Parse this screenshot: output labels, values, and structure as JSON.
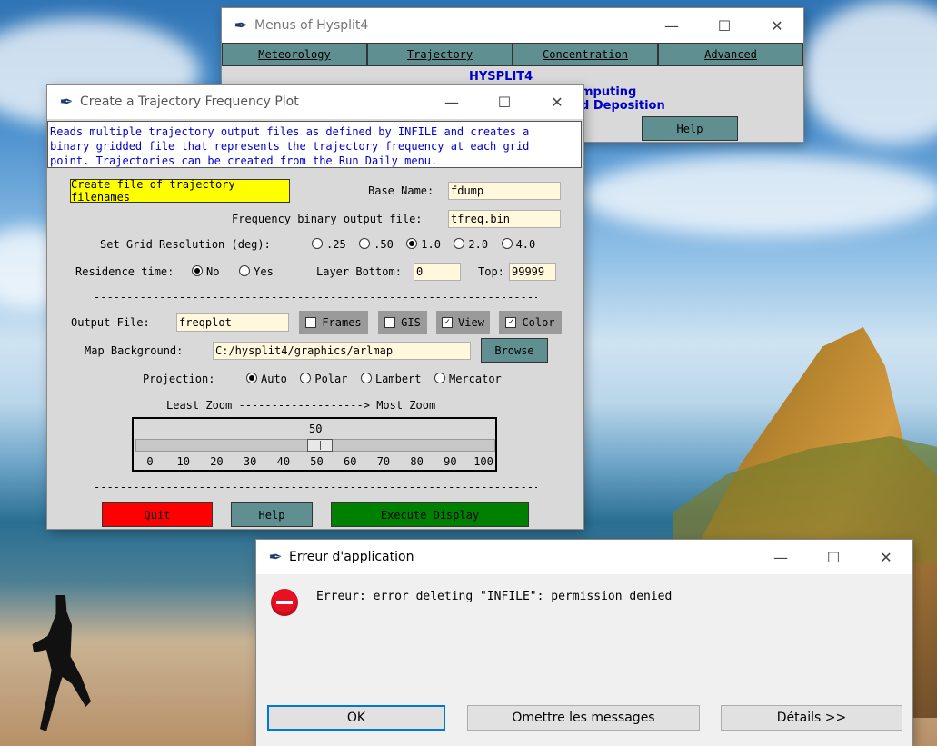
{
  "colors": {
    "yellow_button": "#ffff00",
    "quit_red": "#ff0000",
    "execute_green": "#008000",
    "teal_button": "#5f8f90",
    "entry_bg": "#fff8dc",
    "info_text": "#0000cc",
    "error_red": "#e81123"
  },
  "menus_window": {
    "title": "Menus of Hysplit4",
    "menu": [
      "Meteorology",
      "Trajectory",
      "Concentration",
      "Advanced"
    ],
    "heading": "HYSPLIT4",
    "line2_partial": "mputing",
    "line3_partial": "d Deposition",
    "help_label": "Help"
  },
  "traj_window": {
    "title": "Create a Trajectory Frequency Plot",
    "description": "Reads multiple trajectory output files as defined by INFILE and creates a\nbinary gridded file that represents the trajectory frequency at each grid\npoint. Trajectories can be created from the Run Daily menu.",
    "create_button": "Create file of trajectory filenames",
    "base_name_label": "Base Name:",
    "base_name_value": "fdump",
    "freq_file_label": "Frequency binary output file:",
    "freq_file_value": "tfreq.bin",
    "grid_label": "Set Grid Resolution (deg):",
    "grid_options": [
      ".25",
      ".50",
      "1.0",
      "2.0",
      "4.0"
    ],
    "grid_selected": "1.0",
    "residence_label": "Residence time:",
    "residence_options": [
      "No",
      "Yes"
    ],
    "residence_selected": "No",
    "layer_bottom_label": "Layer Bottom:",
    "layer_bottom_value": "0",
    "top_label": "Top:",
    "top_value": "99999",
    "separator": "----------------------------------------------------------------------",
    "output_file_label": "Output File:",
    "output_file_value": "freqplot",
    "checks": [
      {
        "label": "Frames",
        "checked": false
      },
      {
        "label": "GIS",
        "checked": false
      },
      {
        "label": "View",
        "checked": true
      },
      {
        "label": "Color",
        "checked": true
      }
    ],
    "map_bg_label": "Map Background:",
    "map_bg_value": "C:/hysplit4/graphics/arlmap",
    "browse_label": "Browse",
    "projection_label": "Projection:",
    "projection_options": [
      "Auto",
      "Polar",
      "Lambert",
      "Mercator"
    ],
    "projection_selected": "Auto",
    "zoom_caption": "Least Zoom -------------------> Most Zoom",
    "zoom_value": 50,
    "zoom_value_text": "50",
    "zoom_ticks": [
      "0",
      "10",
      "20",
      "30",
      "40",
      "50",
      "60",
      "70",
      "80",
      "90",
      "100"
    ],
    "quit_label": "Quit",
    "help_label": "Help",
    "execute_label": "Execute Display"
  },
  "error_dialog": {
    "title": "Erreur d'application",
    "message": "Erreur: error deleting \"INFILE\": permission denied",
    "ok_label": "OK",
    "skip_label": "Omettre les messages",
    "details_label": "Détails >>"
  },
  "window_controls": {
    "minimize": "—",
    "maximize": "☐",
    "close": "✕"
  }
}
